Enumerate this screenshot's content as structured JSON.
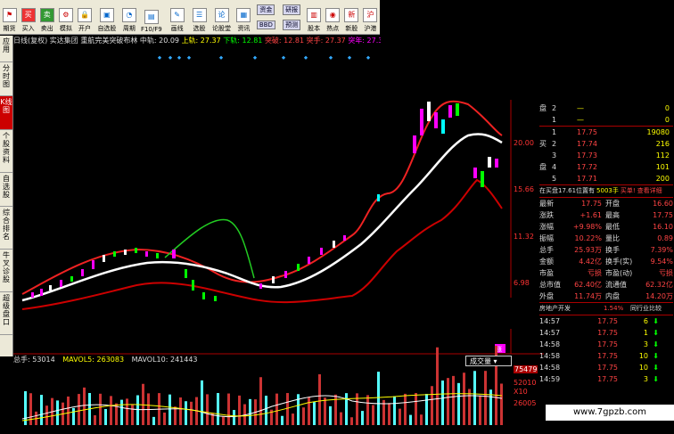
{
  "toolbar": {
    "buttons": [
      {
        "label": "期货",
        "icon": "futures-icon"
      },
      {
        "label": "买入",
        "icon": "buy-icon"
      },
      {
        "label": "卖出",
        "icon": "sell-icon"
      },
      {
        "label": "模拟",
        "icon": "simulate-icon"
      },
      {
        "label": "开户",
        "icon": "open-account-icon"
      },
      {
        "label": "自选股",
        "icon": "watchlist-icon"
      },
      {
        "label": "周期",
        "icon": "period-icon"
      },
      {
        "label": "F10/F9",
        "icon": "f10-icon"
      },
      {
        "label": "画线",
        "icon": "draw-line-icon"
      },
      {
        "label": "选股",
        "icon": "stock-select-icon"
      },
      {
        "label": "论股堂",
        "icon": "forum-icon"
      },
      {
        "label": "资讯",
        "icon": "news-icon"
      }
    ],
    "pill_buttons": [
      "资金",
      "BBD",
      "研报",
      "预测"
    ],
    "right_buttons": [
      {
        "label": "股本",
        "icon": "share-capital-icon"
      },
      {
        "label": "热点",
        "icon": "hotspot-icon"
      },
      {
        "label": "新股",
        "icon": "new-stock-icon"
      },
      {
        "label": "沪港",
        "icon": "hk-connect-icon"
      }
    ]
  },
  "sidebar": {
    "items": [
      "应用",
      "分时图",
      "K线图",
      "个股资料",
      "自选股",
      "综合排名",
      "牛叉诊股",
      "超级盘口"
    ]
  },
  "infobar": {
    "prefix": "日线(复权) 实达集团 重航完美突破布林 中轨: 20.09",
    "upper": "上轨: 27.37",
    "lower": "下轨: 12.81",
    "break": "突破: 12.81",
    "pos": "突手: 27.37",
    "tp": "突年: 27.37",
    "main": "主"
  },
  "price_axis": [
    "20.00",
    "15.66",
    "11.32",
    "6.98"
  ],
  "volume_bar": {
    "total": "总手: 53014",
    "mavol5": "MAVOL5: 263083",
    "mavol10": "MAVOL10: 241443",
    "select_value": "成交量",
    "axis": [
      "75479",
      "52010",
      "X10",
      "26005"
    ]
  },
  "order_book": {
    "sell": [
      {
        "level": "2",
        "price": "—",
        "vol": "0"
      },
      {
        "level": "1",
        "price": "—",
        "vol": "0"
      }
    ],
    "buy": [
      {
        "level": "1",
        "price": "17.75",
        "vol": "19080"
      },
      {
        "level": "2",
        "price": "17.74",
        "vol": "216"
      },
      {
        "level": "3",
        "price": "17.73",
        "vol": "112"
      },
      {
        "level": "4",
        "price": "17.72",
        "vol": "101"
      },
      {
        "level": "5",
        "price": "17.71",
        "vol": "200"
      }
    ],
    "sell_label": "盘",
    "buy_label": "买盘"
  },
  "quote": {
    "notice": "在买盘17.61位置有",
    "notice_vol": "5003手",
    "notice_link": "买单!",
    "notice_detail": "查看详细",
    "rows": [
      [
        "最新",
        "17.75",
        "开盘",
        "16.60"
      ],
      [
        "涨跌",
        "+1.61",
        "最高",
        "17.75"
      ],
      [
        "涨幅",
        "+9.98%",
        "最低",
        "16.10"
      ],
      [
        "振幅",
        "10.22%",
        "量比",
        "0.89"
      ],
      [
        "总手",
        "25.93万",
        "换手",
        "7.39%"
      ],
      [
        "金额",
        "4.42亿",
        "换手(实)",
        "9.54%"
      ],
      [
        "市盈",
        "亏损",
        "市盈(动)",
        "亏损"
      ],
      [
        "总市值",
        "62.40亿",
        "流通值",
        "62.32亿"
      ],
      [
        "外盘",
        "11.74万",
        "内盘",
        "14.20万"
      ]
    ],
    "sector": "房地产开发",
    "sector_pct": "1.54%",
    "sector_link": "同行业比较"
  },
  "ticks": [
    {
      "time": "14:57",
      "price": "17.75",
      "vol": "6"
    },
    {
      "time": "14:57",
      "price": "17.75",
      "vol": "1"
    },
    {
      "time": "14:58",
      "price": "17.75",
      "vol": "3"
    },
    {
      "time": "14:58",
      "price": "17.75",
      "vol": "10"
    },
    {
      "time": "14:58",
      "price": "17.75",
      "vol": "10"
    },
    {
      "time": "14:59",
      "price": "17.75",
      "vol": "3"
    }
  ],
  "watermark": "www.7gpzb.com",
  "chart_marker": "涨"
}
